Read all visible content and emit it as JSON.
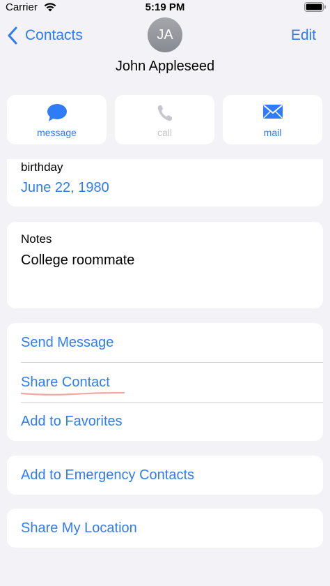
{
  "status_bar": {
    "carrier": "Carrier",
    "time": "5:19 PM"
  },
  "nav": {
    "back_label": "Contacts",
    "edit_label": "Edit"
  },
  "contact": {
    "initials": "JA",
    "name": "John Appleseed"
  },
  "actions": [
    {
      "label": "message",
      "icon": "message-bubble-icon",
      "enabled": true
    },
    {
      "label": "call",
      "icon": "phone-icon",
      "enabled": false
    },
    {
      "label": "mail",
      "icon": "envelope-icon",
      "enabled": true
    }
  ],
  "birthday": {
    "label": "birthday",
    "value": "June 22, 1980"
  },
  "notes": {
    "label": "Notes",
    "value": "College roommate"
  },
  "menu": {
    "send_message": "Send Message",
    "share_contact": "Share Contact",
    "add_favorites": "Add to Favorites",
    "add_emergency": "Add to Emergency Contacts",
    "share_location": "Share My Location"
  },
  "colors": {
    "accent": "#2f7cf6",
    "background": "#f2f2f7",
    "highlight_mark": "#f4a7a0"
  }
}
